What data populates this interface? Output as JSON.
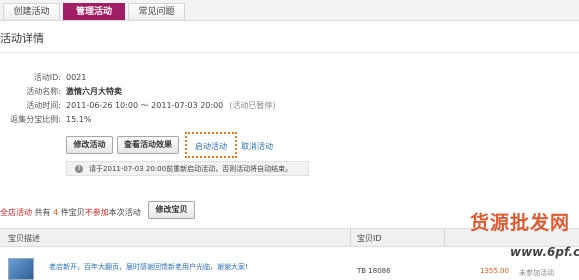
{
  "tabs": [
    {
      "label": "创建活动"
    },
    {
      "label": "管理活动"
    },
    {
      "label": "常见问题"
    }
  ],
  "section": {
    "title": "活动详情"
  },
  "details": {
    "id_label": "活动ID:",
    "id_value": "0021",
    "name_label": "活动名称:",
    "name_value": "激情六月大特卖",
    "time_label": "活动时间:",
    "time_value": "2011-06-26 10:00 ～ 2011-07-03 20:00",
    "time_status": "(活动已暂停)",
    "ratio_label": "返集分宝比例:",
    "ratio_value": "15.1%"
  },
  "buttons": {
    "modify": "修改活动",
    "view_effect": "查看活动效果",
    "start": "启动活动",
    "cancel": "取消活动",
    "modify_items": "修改宝贝"
  },
  "notice": {
    "icon": "info-icon",
    "text": "请于2011-07-03 20:00前重新启动活动，否则活动将自动结束。"
  },
  "items_summary": {
    "prefix": "全店活动",
    "text1": "共有",
    "count": "4",
    "text2": "件宝贝",
    "exclude": "不参加",
    "text3": "本次活动"
  },
  "table": {
    "headers": [
      "宝贝描述",
      "宝贝ID"
    ],
    "rows": [
      {
        "title": "老店新开，百年大翻页，届时感谢回馈新老用户光临，谢谢大家!",
        "id": "TB 18086",
        "price": "1355.00",
        "status": "未参加活动"
      }
    ]
  },
  "watermark": {
    "text": "货源批发网",
    "url": "www.6pf.cn"
  },
  "colors": {
    "accent": "#a11e64",
    "link": "#2d6fb6",
    "highlight": "#e07a2a",
    "warning": "#e05a1a"
  }
}
